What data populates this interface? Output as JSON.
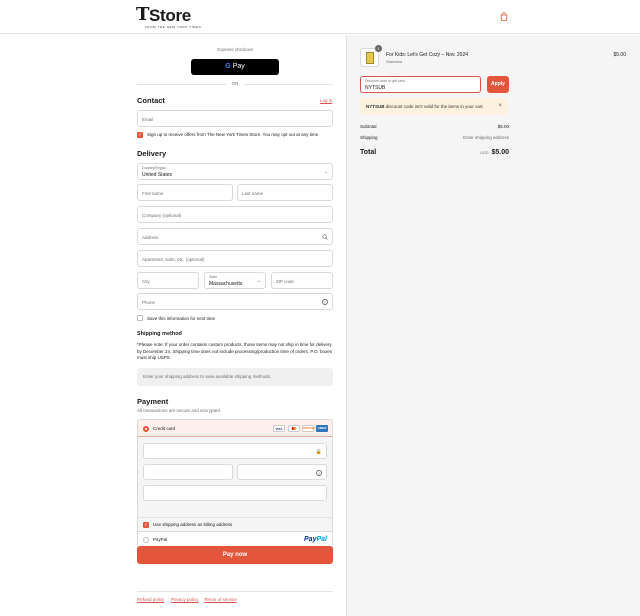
{
  "header": {
    "logo_t": "T",
    "logo_store": "Store",
    "logo_sub": "FROM THE NEW YORK TIMES",
    "cart_icon": "shopping-bag-icon"
  },
  "express": {
    "label": "Express checkout",
    "gpay_g": "G",
    "gpay_label": "Pay",
    "or": "OR"
  },
  "contact": {
    "heading": "Contact",
    "login": "Log in",
    "email_placeholder": "Email",
    "optin_label": "Sign up to receive offers from The New York Times Store. You may opt out at any time.",
    "optin_checked": true
  },
  "delivery": {
    "heading": "Delivery",
    "country_label": "Country/Region",
    "country_value": "United States",
    "first_name": "First name",
    "last_name": "Last name",
    "company": "Company (optional)",
    "address": "Address",
    "apartment": "Apartment, suite, etc. (optional)",
    "city": "City",
    "state_label": "State",
    "state_value": "Massachusetts",
    "zip": "ZIP code",
    "phone": "Phone",
    "save_info": "Save this information for next time"
  },
  "shipping_method": {
    "heading": "Shipping method",
    "note": "*Please note: If your order contains custom products, those items may not ship in time for delivery by December 24. Shipping time does not include processing/production time of orders. P.O. boxes must ship USPS.",
    "placeholder": "Enter your shipping address to view available shipping methods."
  },
  "payment": {
    "heading": "Payment",
    "subtext": "All transactions are secure and encrypted.",
    "credit_card": "Credit card",
    "card_logos": [
      "VISA",
      "MC",
      "DISCOVER",
      "AMEX"
    ],
    "billing_same": "Use shipping address as billing address",
    "paypal": "PayPal",
    "paypal_logo_1": "Pay",
    "paypal_logo_2": "Pal"
  },
  "pay_now": "Pay now",
  "footer": {
    "refund": "Refund policy",
    "privacy": "Privacy policy",
    "terms": "Terms of service"
  },
  "summary": {
    "item": {
      "qty": "1",
      "title": "For Kids: Let's Get Cozy – Nov. 2024",
      "variant": "Standard",
      "price": "$5.00"
    },
    "discount_label": "Discount code or gift card",
    "discount_value": "NYTSUB",
    "apply": "Apply",
    "banner_code": "NYTSUB",
    "banner_text": " discount code isn't valid for the items in your cart",
    "subtotal_label": "Subtotal",
    "subtotal_value": "$5.00",
    "shipping_label": "Shipping",
    "shipping_value": "Enter shipping address",
    "total_label": "Total",
    "total_currency": "USD",
    "total_value": "$5.00"
  },
  "colors": {
    "accent": "#e4563c",
    "summary_bg": "#f5f5f5",
    "banner_bg": "#fdf2e0"
  }
}
